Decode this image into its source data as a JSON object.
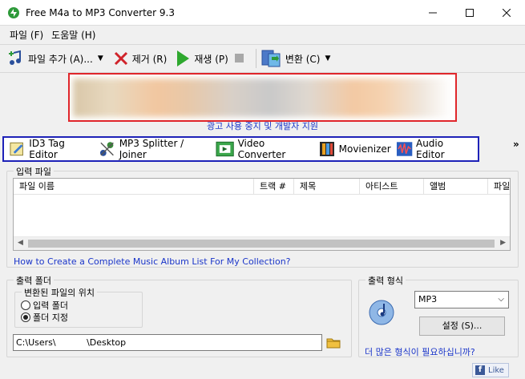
{
  "window": {
    "title": "Free M4a to MP3 Converter 9.3"
  },
  "menu": {
    "file": "파일 (F)",
    "help": "도움말 (H)"
  },
  "toolbar": {
    "add_files": "파일 추가 (A)...",
    "remove": "제거 (R)",
    "play": "재생 (P)",
    "convert": "변환 (C)"
  },
  "ad": {
    "caption": "광고 사용 중지 및 개발자 지원"
  },
  "tools": [
    "ID3 Tag Editor",
    "MP3 Splitter / Joiner",
    "Video Converter",
    "Movienizer",
    "Audio Editor"
  ],
  "input_files": {
    "label": "입력 파일",
    "columns": [
      "파일 이름",
      "트랙 #",
      "제목",
      "아티스트",
      "앨범",
      "파일"
    ]
  },
  "help_link": "How to Create a Complete Music Album List For My Collection?",
  "output_folder": {
    "label": "출력 폴더",
    "location_label": "변환된 파일의 위치",
    "option_input_folder": "입력 폴더",
    "option_specify_folder": "폴더 지정",
    "selected_option": "폴더 지정",
    "path": "C:\\Users\\           \\Desktop"
  },
  "output_format": {
    "label": "출력 형식",
    "selected": "MP3",
    "settings_button": "설정 (S)...",
    "more_formats_link": "더 많은 형식이 필요하십니까?"
  },
  "like_button": "Like",
  "colors": {
    "ad_border": "#e0262b",
    "tools_border": "#1e22b8",
    "link": "#1a35c9"
  }
}
